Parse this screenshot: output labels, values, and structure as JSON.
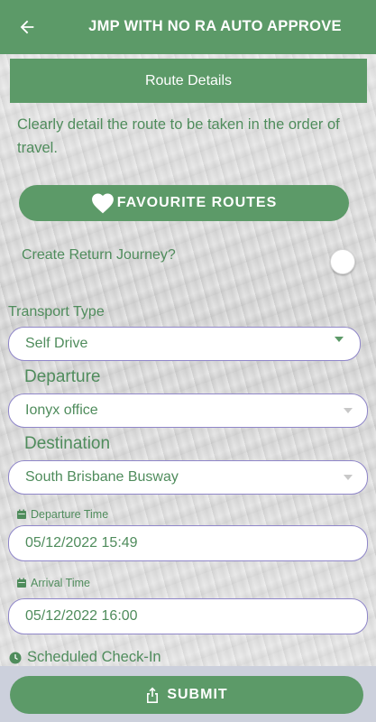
{
  "header": {
    "title": "JMP WITH NO RA AUTO APPROVE",
    "back_icon": "arrow-left-icon"
  },
  "section": {
    "title": "Route Details",
    "instructions": "Clearly detail the route to be taken in the order of travel."
  },
  "favourite_button": {
    "label": "FAVOURITE ROUTES",
    "icon": "heart-icon"
  },
  "return_journey": {
    "label": "Create Return Journey?",
    "enabled": false
  },
  "transport": {
    "label": "Transport Type",
    "value": "Self Drive"
  },
  "departure": {
    "label": "Departure",
    "value": "Ionyx office"
  },
  "destination": {
    "label": "Destination",
    "value": "South Brisbane Busway"
  },
  "departure_time": {
    "label": "Departure Time",
    "value": "05/12/2022 15:49",
    "icon": "calendar-icon"
  },
  "arrival_time": {
    "label": "Arrival Time",
    "value": "05/12/2022 16:00",
    "icon": "calendar-icon"
  },
  "checkin": {
    "label": "Scheduled Check-In",
    "icon": "clock-icon"
  },
  "submit": {
    "label": "SUBMIT",
    "icon": "share-icon"
  },
  "colors": {
    "primary": "#5c9a68",
    "text_green": "#4f8c5c",
    "field_border": "#8f86c9",
    "bottom_bar": "#ccd0dc"
  }
}
